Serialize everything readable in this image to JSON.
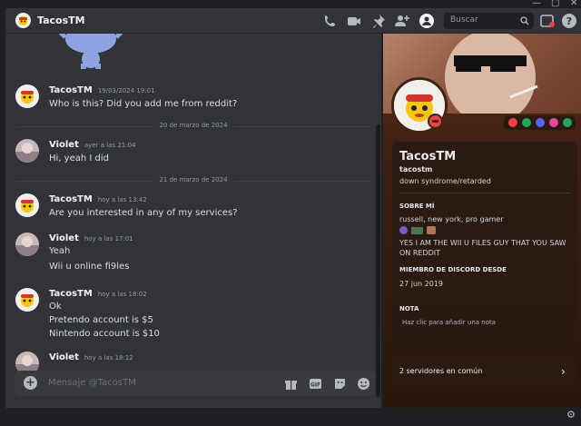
{
  "header": {
    "name": "TacosTM",
    "search_placeholder": "Buscar"
  },
  "messages": [
    {
      "author": "TacosTM",
      "time": "19/03/2024 19:01",
      "lines": [
        "Who is this? Did you add me from reddit?"
      ]
    },
    {
      "divider": "20 de marzo de 2024"
    },
    {
      "author": "Violet",
      "time": "ayer a las 21:04",
      "lines": [
        "Hi, yeah I did"
      ]
    },
    {
      "divider": "21 de marzo de 2024"
    },
    {
      "author": "TacosTM",
      "time": "hoy a las 13:42",
      "lines": [
        "Are you interested in any of my services?"
      ]
    },
    {
      "author": "Violet",
      "time": "hoy a las 17:01",
      "lines": [
        "Yeah",
        "Wii u online fi9les"
      ]
    },
    {
      "author": "TacosTM",
      "time": "hoy a las 18:02",
      "lines": [
        "Ok",
        "Pretendo account is $5",
        "Nintendo account is $10"
      ]
    },
    {
      "author": "Violet",
      "time": "hoy a las 18:12",
      "lines": []
    }
  ],
  "composer": {
    "placeholder": "Mensaje @TacosTM"
  },
  "profile": {
    "display_name": "TacosTM",
    "username": "tacostm",
    "status": "down syndrome/retarded",
    "about_heading": "SOBRE MÍ",
    "about_line1": "russell, new york, pro gamer",
    "about_line2": "YES I AM THE WII U FILES GUY THAT YOU SAW ON REDDIT",
    "member_heading": "MIEMBRO DE DISCORD DESDE",
    "member_date": "27 jun 2019",
    "note_heading": "NOTA",
    "note_placeholder": "Haz clic para añadir una nota",
    "mutual_servers": "2 servidores en común"
  }
}
